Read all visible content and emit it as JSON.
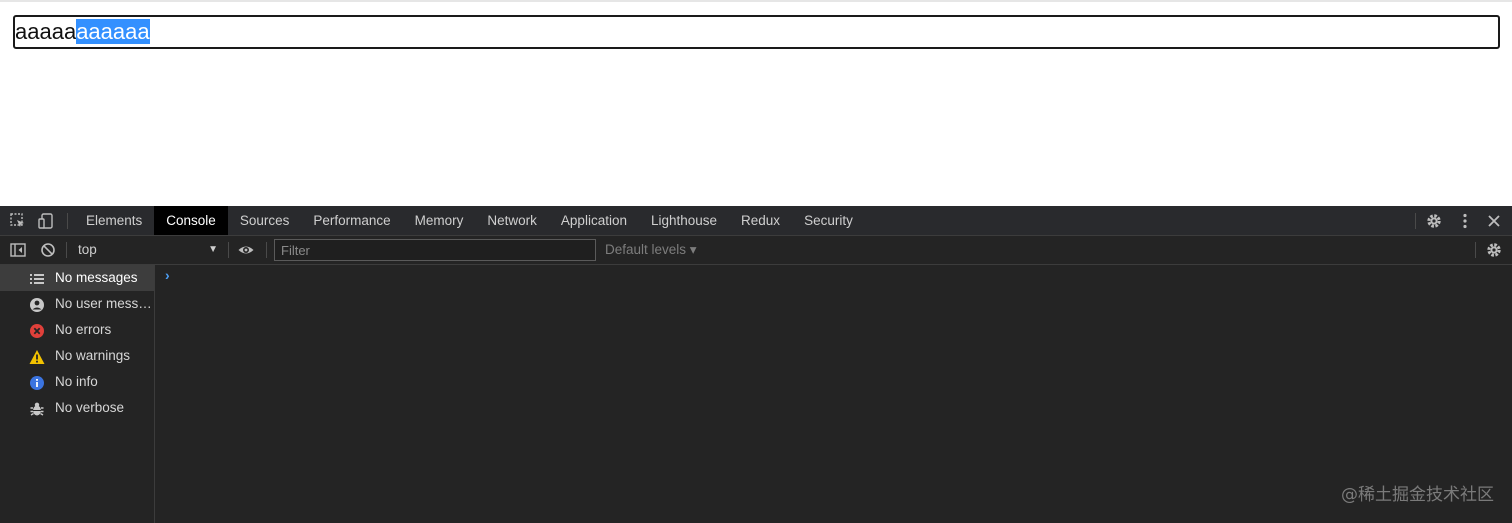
{
  "page": {
    "input_text_unselected": "aaaaa",
    "input_text_selected": "aaaaaa"
  },
  "devtools": {
    "tabs": [
      {
        "label": "Elements",
        "active": false
      },
      {
        "label": "Console",
        "active": true
      },
      {
        "label": "Sources",
        "active": false
      },
      {
        "label": "Performance",
        "active": false
      },
      {
        "label": "Memory",
        "active": false
      },
      {
        "label": "Network",
        "active": false
      },
      {
        "label": "Application",
        "active": false
      },
      {
        "label": "Lighthouse",
        "active": false
      },
      {
        "label": "Redux",
        "active": false
      },
      {
        "label": "Security",
        "active": false
      }
    ],
    "toolbar": {
      "context": "top",
      "filter_placeholder": "Filter",
      "filter_value": "",
      "levels_label": "Default levels ▾"
    },
    "sidebar": {
      "items": [
        {
          "label": "No messages",
          "icon": "list-icon",
          "selected": true
        },
        {
          "label": "No user messa...",
          "icon": "user-icon",
          "selected": false
        },
        {
          "label": "No errors",
          "icon": "error-icon",
          "selected": false
        },
        {
          "label": "No warnings",
          "icon": "warning-icon",
          "selected": false
        },
        {
          "label": "No info",
          "icon": "info-icon",
          "selected": false
        },
        {
          "label": "No verbose",
          "icon": "bug-icon",
          "selected": false
        }
      ]
    },
    "console": {
      "prompt": "›"
    }
  },
  "watermark": "@稀土掘金技术社区",
  "colors": {
    "selection": "#3390ff",
    "devtools_bg": "#242424",
    "active_tab_bg": "#000000",
    "error": "#e0403a",
    "warning": "#f2c200",
    "info": "#3b74e0",
    "prompt": "#4d9ff5"
  }
}
